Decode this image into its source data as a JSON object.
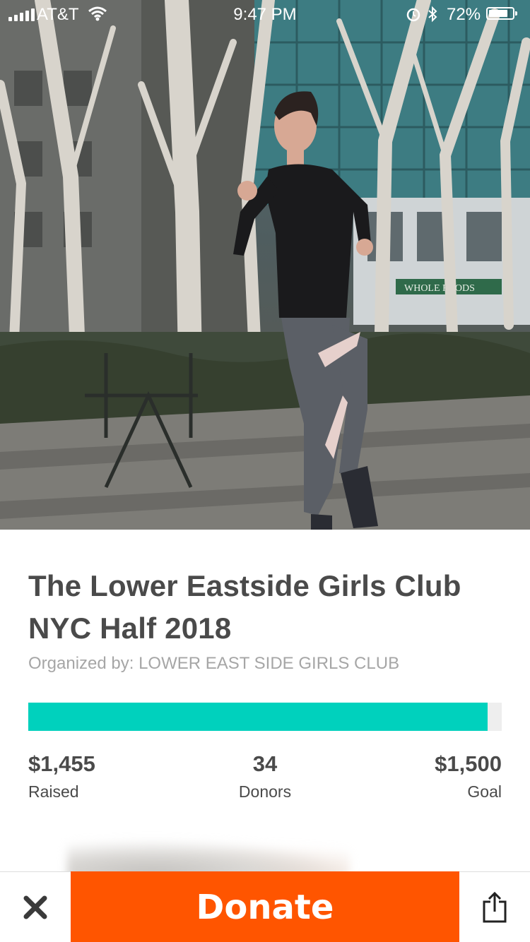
{
  "status_bar": {
    "carrier": "AT&T",
    "time": "9:47 PM",
    "battery": "72%"
  },
  "hero": {
    "storefront_sign": "WHOLE FOODS"
  },
  "campaign": {
    "title_line1": "The Lower Eastside Girls Club",
    "title_line2": "NYC Half 2018",
    "organizer": "Organized by: LOWER EAST SIDE GIRLS CLUB"
  },
  "progress": {
    "fraction": 0.97,
    "color": "#00d1bd"
  },
  "stats": {
    "raised_value": "$1,455",
    "raised_label": "Raised",
    "donors_value": "34",
    "donors_label": "Donors",
    "goal_value": "$1,500",
    "goal_label": "Goal"
  },
  "bottom_bar": {
    "close_icon": "close-icon",
    "donate_label": "Donate",
    "donate_color": "#ff5500",
    "share_icon": "share-icon"
  }
}
